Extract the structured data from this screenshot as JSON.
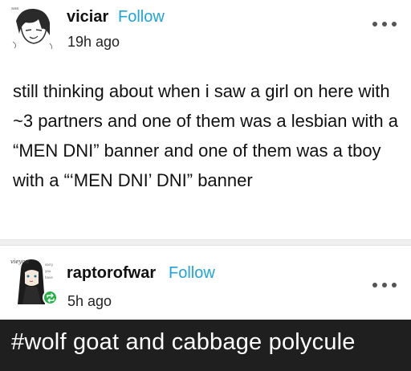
{
  "posts": [
    {
      "username": "viciar",
      "follow_label": "Follow",
      "timestamp": "19h ago",
      "body": "still thinking about when i saw a girl on here with ~3 partners and one of them was a lesbian with a “MEN DNI” banner and one of them was a tboy with a “‘MEN DNI’ DNI” banner",
      "avatar_icon": "sketch-face-avatar",
      "more_icon": "more-dots-icon"
    },
    {
      "username": "raptorofwar",
      "follow_label": "Follow",
      "timestamp": "5h ago",
      "avatar_icon": "anime-girl-avatar",
      "badge_icon": "reblog-icon",
      "more_icon": "more-dots-icon"
    }
  ],
  "tag": "#wolf goat and cabbage polycule",
  "colors": {
    "follow": "#1ea4d8",
    "reblog_badge": "#25b04a",
    "tag_bar": "#1f1f1f"
  }
}
